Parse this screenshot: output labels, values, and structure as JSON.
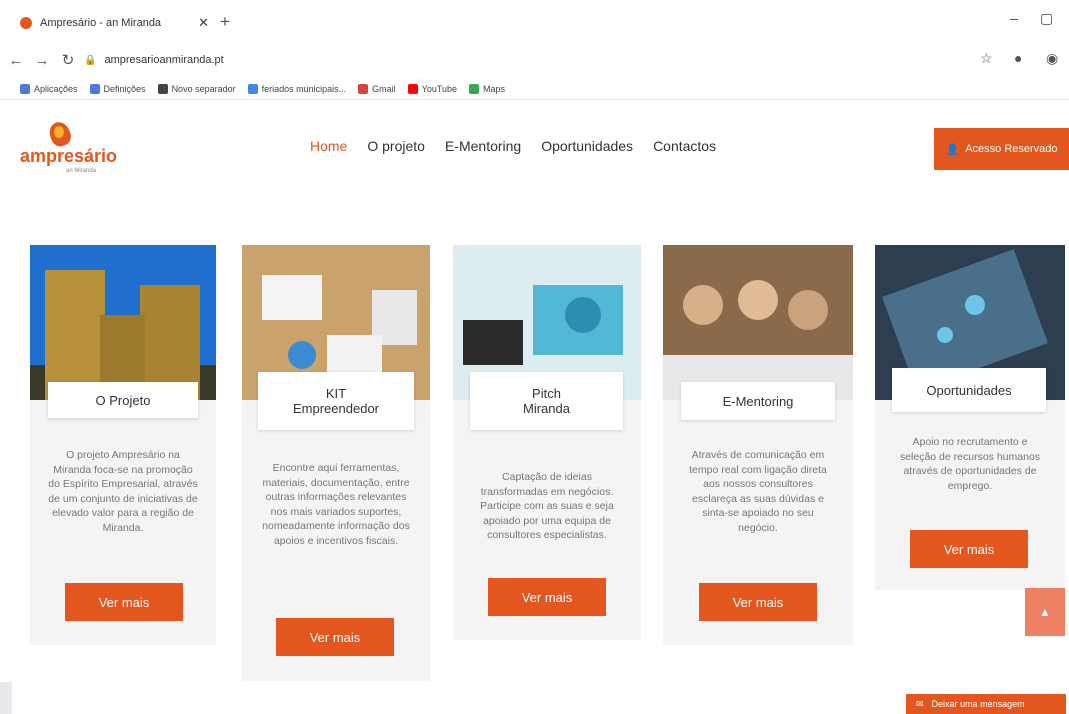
{
  "browser": {
    "tab_title": "Ampresário - an Miranda",
    "tab_close": "✕",
    "new_tab": "+",
    "url": "ampresarioanmiranda.pt",
    "window_min": "–",
    "window_restore": "▢",
    "bookmarks": [
      {
        "label": "Aplicações",
        "color": "#4a7bd8"
      },
      {
        "label": "Definições",
        "color": "#4a7bd8"
      },
      {
        "label": "Novo separador",
        "color": "#444"
      },
      {
        "label": "feriados municipais...",
        "color": "#4285f4"
      },
      {
        "label": "Gmail",
        "color": "#d44638"
      },
      {
        "label": "YouTube",
        "color": "#ff0000"
      },
      {
        "label": "Maps",
        "color": "#34a853"
      }
    ]
  },
  "site": {
    "logo_word": "ampresário",
    "logo_sub": "an Miranda",
    "nav": [
      "Home",
      "O projeto",
      "E-Mentoring",
      "Oportunidades",
      "Contactos"
    ],
    "access_label": "Acesso Reservado",
    "accent": "#e3571f"
  },
  "cards": [
    {
      "title": "O Projeto",
      "desc": "O projeto Ampresário na Miranda foca-se na promoção do Espírito Empresarial, através de um conjunto de iniciativas de elevado valor para a região de Miranda.",
      "button": "Ver mais"
    },
    {
      "title": "KIT\nEmpreendedor",
      "desc": "Encontre aqui ferramentas, materiais, documentação, entre outras informações relevantes nos mais variados suportes, nomeadamente informação dos apoios e incentivos fiscais.",
      "button": "Ver mais"
    },
    {
      "title": "Pitch\nMiranda",
      "desc": "Captação de ideias transformadas em negócios. Participe com as suas e seja apoiado por uma equipa de consultores especialistas.",
      "button": "Ver mais"
    },
    {
      "title": "E-Mentoring",
      "desc": "Através de comunicação em tempo real com ligação direta aos nossos consultores esclareça as suas dúvidas e sinta-se apoiado no seu negócio.",
      "button": "Ver mais"
    },
    {
      "title": "Oportunidades",
      "desc": "Apoio no recrutamento e seleção de recursos humanos através de oportunidades de emprego.",
      "button": "Ver mais"
    }
  ],
  "footer": {
    "message_label": "Deixar uma mensagem",
    "scroll_icon": "▲"
  }
}
